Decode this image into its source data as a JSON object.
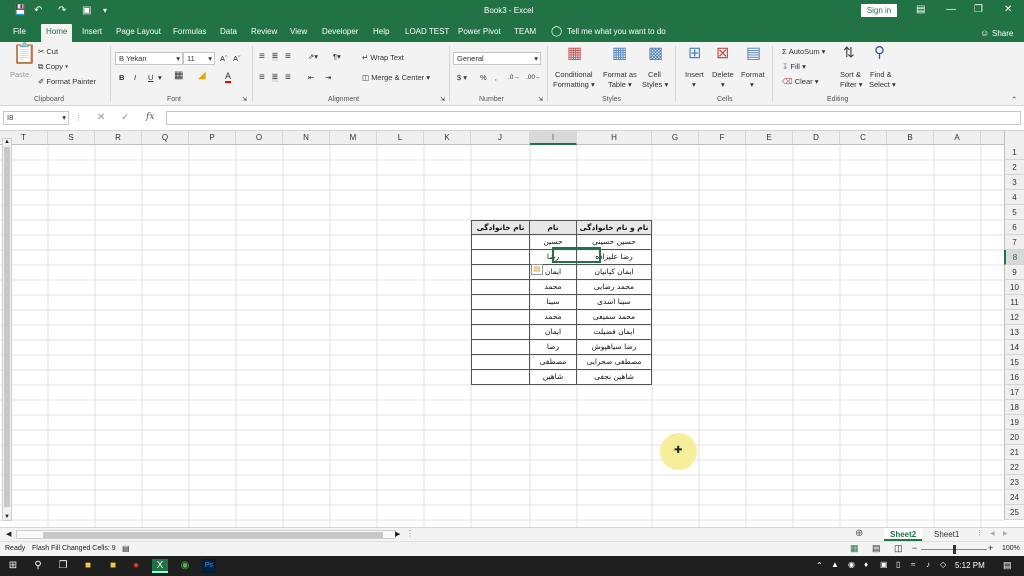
{
  "window": {
    "title": "Book3 - Excel",
    "sign_in": "Sign in"
  },
  "tabs": [
    "File",
    "Home",
    "Insert",
    "Page Layout",
    "Formulas",
    "Data",
    "Review",
    "View",
    "Developer",
    "Help",
    "LOAD TEST",
    "Power Pivot",
    "TEAM"
  ],
  "tell_me": "Tell me what you want to do",
  "share": "Share",
  "ribbon": {
    "clipboard": {
      "paste": "Paste",
      "cut": "Cut",
      "copy": "Copy",
      "format_painter": "Format Painter",
      "group": "Clipboard"
    },
    "font": {
      "name": "B Yekan",
      "size": "11",
      "group": "Font"
    },
    "alignment": {
      "wrap": "Wrap Text",
      "merge": "Merge & Center",
      "group": "Alignment"
    },
    "number": {
      "format": "General",
      "group": "Number"
    },
    "styles": {
      "cond1": "Conditional",
      "cond2": "Formatting",
      "fmt1": "Format as",
      "fmt2": "Table",
      "cell1": "Cell",
      "cell2": "Styles",
      "group": "Styles"
    },
    "cells": {
      "insert": "Insert",
      "delete": "Delete",
      "format": "Format",
      "group": "Cells"
    },
    "editing": {
      "autosum": "AutoSum",
      "fill": "Fill",
      "clear": "Clear",
      "sort1": "Sort &",
      "sort2": "Filter",
      "find1": "Find &",
      "find2": "Select",
      "group": "Editing"
    }
  },
  "formula_bar": {
    "name_box": "I8",
    "fx": "fx",
    "value": ""
  },
  "columns": [
    "T",
    "S",
    "R",
    "Q",
    "P",
    "O",
    "N",
    "M",
    "L",
    "K",
    "J",
    "I",
    "H",
    "G",
    "F",
    "E",
    "D",
    "C",
    "B",
    "A"
  ],
  "selected_column": "I",
  "rows": [
    "1",
    "2",
    "3",
    "4",
    "5",
    "6",
    "7",
    "8",
    "9",
    "10",
    "11",
    "12",
    "13",
    "14",
    "15",
    "16",
    "17",
    "18",
    "19",
    "20",
    "21",
    "22",
    "23",
    "24",
    "25"
  ],
  "selected_row": "8",
  "table": {
    "headers": {
      "H": "نام و نام خانوادگی",
      "I": "نام",
      "J": "نام خانوادگی"
    },
    "full_names": [
      "حسین حسینی",
      "رضا علیزاده",
      "ایمان کیانیان",
      "محمد رضایی",
      "سینا اسدی",
      "محمد سمیعی",
      "ایمان فضیلت",
      "رضا سیاهپوش",
      "مصطفی صحرایی",
      "شاهین نجفی"
    ],
    "first_names": [
      "حسین",
      "رضا",
      "ایمان",
      "محمد",
      "سینا",
      "محمد",
      "ایمان",
      "رضا",
      "مصطفی",
      "شاهین"
    ]
  },
  "sheets": [
    "Sheet2",
    "Sheet1"
  ],
  "active_sheet": "Sheet2",
  "status": {
    "ready": "Ready",
    "message": "Flash Fill Changed Cells: 9",
    "zoom": "100%"
  },
  "taskbar": {
    "time": "5:12 PM"
  },
  "colors": {
    "excel_green": "#217346",
    "taskbar": "#1f1f1f",
    "highlight": "#f7ee9c"
  }
}
